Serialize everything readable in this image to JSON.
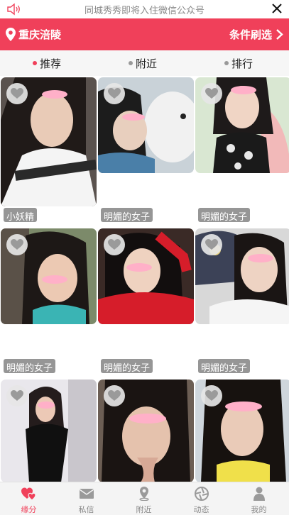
{
  "notice": {
    "text": "同城秀秀即将入住微信公众号",
    "icons": {
      "speaker": "speaker-icon",
      "close": "close-icon"
    }
  },
  "header": {
    "location": "重庆涪陵",
    "filter": "条件刷选",
    "icons": {
      "location": "location-pin-icon",
      "chevron": "chevron-right-icon"
    },
    "color": "#f0405a"
  },
  "tabs": [
    {
      "label": "推荐",
      "active": true
    },
    {
      "label": "附近",
      "active": false
    },
    {
      "label": "排行",
      "active": false
    }
  ],
  "profiles": [
    {
      "name": "小妖精"
    },
    {
      "name": "明媚的女子"
    },
    {
      "name": "明媚的女子"
    },
    {
      "name": "明媚的女子"
    },
    {
      "name": "明媚的女子"
    },
    {
      "name": "明媚的女子"
    },
    {
      "name": ""
    },
    {
      "name": ""
    },
    {
      "name": ""
    }
  ],
  "bottom_nav": [
    {
      "label": "缘分",
      "icon": "hearts-icon",
      "active": true
    },
    {
      "label": "私信",
      "icon": "envelope-icon",
      "active": false
    },
    {
      "label": "附近",
      "icon": "location-pin-icon",
      "active": false
    },
    {
      "label": "动态",
      "icon": "aperture-icon",
      "active": false
    },
    {
      "label": "我的",
      "icon": "person-icon",
      "active": false
    }
  ],
  "colors": {
    "accent": "#f0405a",
    "inactive": "#888888"
  }
}
